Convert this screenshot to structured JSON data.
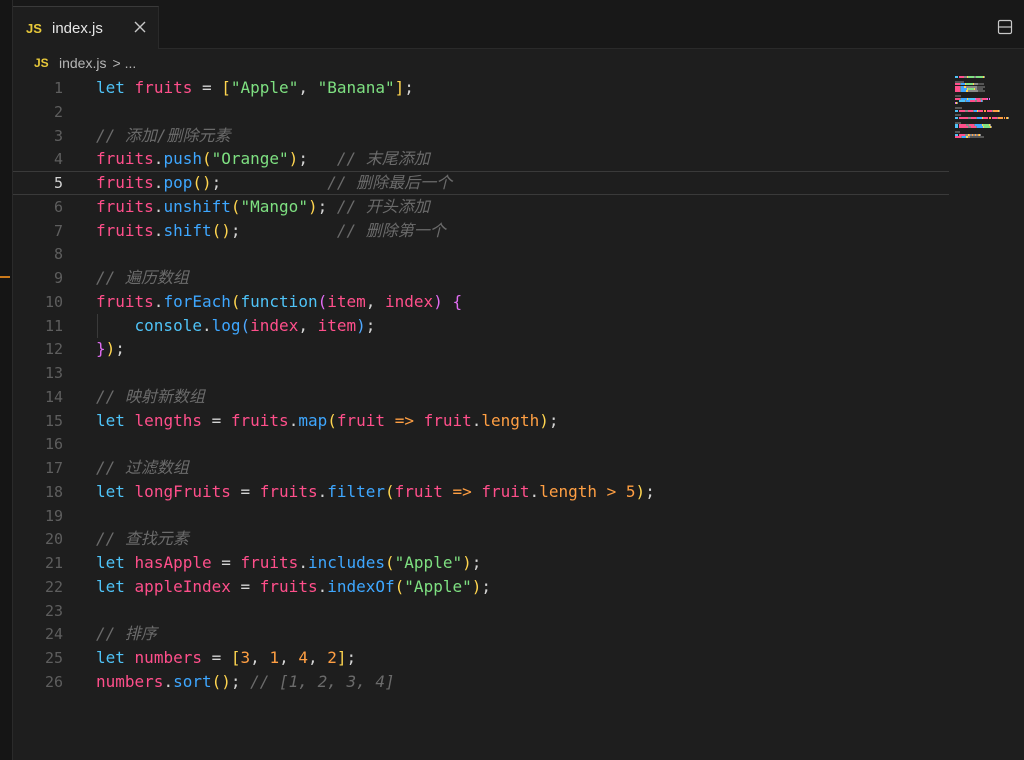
{
  "tab": {
    "icon": "JS",
    "label": "index.js"
  },
  "breadcrumb": {
    "icon": "JS",
    "file": "index.js",
    "separator": ">",
    "more": "..."
  },
  "editor": {
    "current_line": 5,
    "line_numbers": [
      "1",
      "2",
      "3",
      "4",
      "5",
      "6",
      "7",
      "8",
      "9",
      "10",
      "11",
      "12",
      "13",
      "14",
      "15",
      "16",
      "17",
      "18",
      "19",
      "20",
      "21",
      "22",
      "23",
      "24",
      "25",
      "26"
    ],
    "lines": [
      [
        [
          "kw",
          "let"
        ],
        [
          "pn",
          " "
        ],
        [
          "vr",
          "fruits"
        ],
        [
          "pn",
          " = "
        ],
        [
          "yl",
          "["
        ],
        [
          "st",
          "\"Apple\""
        ],
        [
          "pn",
          ", "
        ],
        [
          "st",
          "\"Banana\""
        ],
        [
          "yl",
          "]"
        ],
        [
          "pn",
          ";"
        ]
      ],
      [],
      [
        [
          "cm",
          "// 添加/删除元素"
        ]
      ],
      [
        [
          "vr",
          "fruits"
        ],
        [
          "pn",
          "."
        ],
        [
          "mt",
          "push"
        ],
        [
          "yl",
          "("
        ],
        [
          "st",
          "\"Orange\""
        ],
        [
          "yl",
          ")"
        ],
        [
          "pn",
          ";   "
        ],
        [
          "cm",
          "// 末尾添加"
        ]
      ],
      [
        [
          "vr",
          "fruits"
        ],
        [
          "pn",
          "."
        ],
        [
          "mt",
          "pop"
        ],
        [
          "yl",
          "()"
        ],
        [
          "pn",
          ";           "
        ],
        [
          "cm",
          "// 删除最后一个"
        ]
      ],
      [
        [
          "vr",
          "fruits"
        ],
        [
          "pn",
          "."
        ],
        [
          "mt",
          "unshift"
        ],
        [
          "yl",
          "("
        ],
        [
          "st",
          "\"Mango\""
        ],
        [
          "yl",
          ")"
        ],
        [
          "pn",
          "; "
        ],
        [
          "cm",
          "// 开头添加"
        ]
      ],
      [
        [
          "vr",
          "fruits"
        ],
        [
          "pn",
          "."
        ],
        [
          "mt",
          "shift"
        ],
        [
          "yl",
          "()"
        ],
        [
          "pn",
          ";          "
        ],
        [
          "cm",
          "// 删除第一个"
        ]
      ],
      [],
      [
        [
          "cm",
          "// 遍历数组"
        ]
      ],
      [
        [
          "vr",
          "fruits"
        ],
        [
          "pn",
          "."
        ],
        [
          "mt",
          "forEach"
        ],
        [
          "yl",
          "("
        ],
        [
          "fn",
          "function"
        ],
        [
          "br2",
          "("
        ],
        [
          "pa",
          "item"
        ],
        [
          "pn",
          ", "
        ],
        [
          "pa",
          "index"
        ],
        [
          "br2",
          ")"
        ],
        [
          "pn",
          " "
        ],
        [
          "br2",
          "{"
        ]
      ],
      [
        [
          "pn",
          "    "
        ],
        [
          "fn",
          "console"
        ],
        [
          "pn",
          "."
        ],
        [
          "mt",
          "log"
        ],
        [
          "br3",
          "("
        ],
        [
          "pa",
          "index"
        ],
        [
          "pn",
          ", "
        ],
        [
          "pa",
          "item"
        ],
        [
          "br3",
          ")"
        ],
        [
          "pn",
          ";"
        ]
      ],
      [
        [
          "br2",
          "}"
        ],
        [
          "yl",
          ")"
        ],
        [
          "pn",
          ";"
        ]
      ],
      [],
      [
        [
          "cm",
          "// 映射新数组"
        ]
      ],
      [
        [
          "kw",
          "let"
        ],
        [
          "pn",
          " "
        ],
        [
          "vr",
          "lengths"
        ],
        [
          "pn",
          " = "
        ],
        [
          "vr",
          "fruits"
        ],
        [
          "pn",
          "."
        ],
        [
          "mt",
          "map"
        ],
        [
          "yl",
          "("
        ],
        [
          "pa",
          "fruit"
        ],
        [
          "pn",
          " "
        ],
        [
          "op",
          "=>"
        ],
        [
          "pn",
          " "
        ],
        [
          "vr",
          "fruit"
        ],
        [
          "pn",
          "."
        ],
        [
          "pr",
          "length"
        ],
        [
          "yl",
          ")"
        ],
        [
          "pn",
          ";"
        ]
      ],
      [],
      [
        [
          "cm",
          "// 过滤数组"
        ]
      ],
      [
        [
          "kw",
          "let"
        ],
        [
          "pn",
          " "
        ],
        [
          "vr",
          "longFruits"
        ],
        [
          "pn",
          " = "
        ],
        [
          "vr",
          "fruits"
        ],
        [
          "pn",
          "."
        ],
        [
          "mt",
          "filter"
        ],
        [
          "yl",
          "("
        ],
        [
          "pa",
          "fruit"
        ],
        [
          "pn",
          " "
        ],
        [
          "op",
          "=>"
        ],
        [
          "pn",
          " "
        ],
        [
          "vr",
          "fruit"
        ],
        [
          "pn",
          "."
        ],
        [
          "pr",
          "length"
        ],
        [
          "pn",
          " "
        ],
        [
          "op",
          ">"
        ],
        [
          "pn",
          " "
        ],
        [
          "nm",
          "5"
        ],
        [
          "yl",
          ")"
        ],
        [
          "pn",
          ";"
        ]
      ],
      [],
      [
        [
          "cm",
          "// 查找元素"
        ]
      ],
      [
        [
          "kw",
          "let"
        ],
        [
          "pn",
          " "
        ],
        [
          "vr",
          "hasApple"
        ],
        [
          "pn",
          " = "
        ],
        [
          "vr",
          "fruits"
        ],
        [
          "pn",
          "."
        ],
        [
          "mt",
          "includes"
        ],
        [
          "yl",
          "("
        ],
        [
          "st",
          "\"Apple\""
        ],
        [
          "yl",
          ")"
        ],
        [
          "pn",
          ";"
        ]
      ],
      [
        [
          "kw",
          "let"
        ],
        [
          "pn",
          " "
        ],
        [
          "vr",
          "appleIndex"
        ],
        [
          "pn",
          " = "
        ],
        [
          "vr",
          "fruits"
        ],
        [
          "pn",
          "."
        ],
        [
          "mt",
          "indexOf"
        ],
        [
          "yl",
          "("
        ],
        [
          "st",
          "\"Apple\""
        ],
        [
          "yl",
          ")"
        ],
        [
          "pn",
          ";"
        ]
      ],
      [],
      [
        [
          "cm",
          "// 排序"
        ]
      ],
      [
        [
          "kw",
          "let"
        ],
        [
          "pn",
          " "
        ],
        [
          "vr",
          "numbers"
        ],
        [
          "pn",
          " = "
        ],
        [
          "yl",
          "["
        ],
        [
          "nm",
          "3"
        ],
        [
          "pn",
          ", "
        ],
        [
          "nm",
          "1"
        ],
        [
          "pn",
          ", "
        ],
        [
          "nm",
          "4"
        ],
        [
          "pn",
          ", "
        ],
        [
          "nm",
          "2"
        ],
        [
          "yl",
          "]"
        ],
        [
          "pn",
          ";"
        ]
      ],
      [
        [
          "vr",
          "numbers"
        ],
        [
          "pn",
          "."
        ],
        [
          "mt",
          "sort"
        ],
        [
          "yl",
          "()"
        ],
        [
          "pn",
          "; "
        ],
        [
          "cm",
          "// [1, 2, 3, 4]"
        ]
      ]
    ]
  },
  "colors": {
    "background": "#1e1e1e",
    "tabbar": "#181818",
    "js_badge": "#e8c93a",
    "keyword": "#4fc3f7",
    "variable": "#ff4f8b",
    "method": "#3ea7ff",
    "string": "#7ee081",
    "number": "#ff9f43",
    "comment": "#6b6b6b"
  },
  "icons": {
    "close": "close-icon",
    "split_editor": "split-editor-icon",
    "breadcrumb_chevron": "chevron-right-icon"
  }
}
